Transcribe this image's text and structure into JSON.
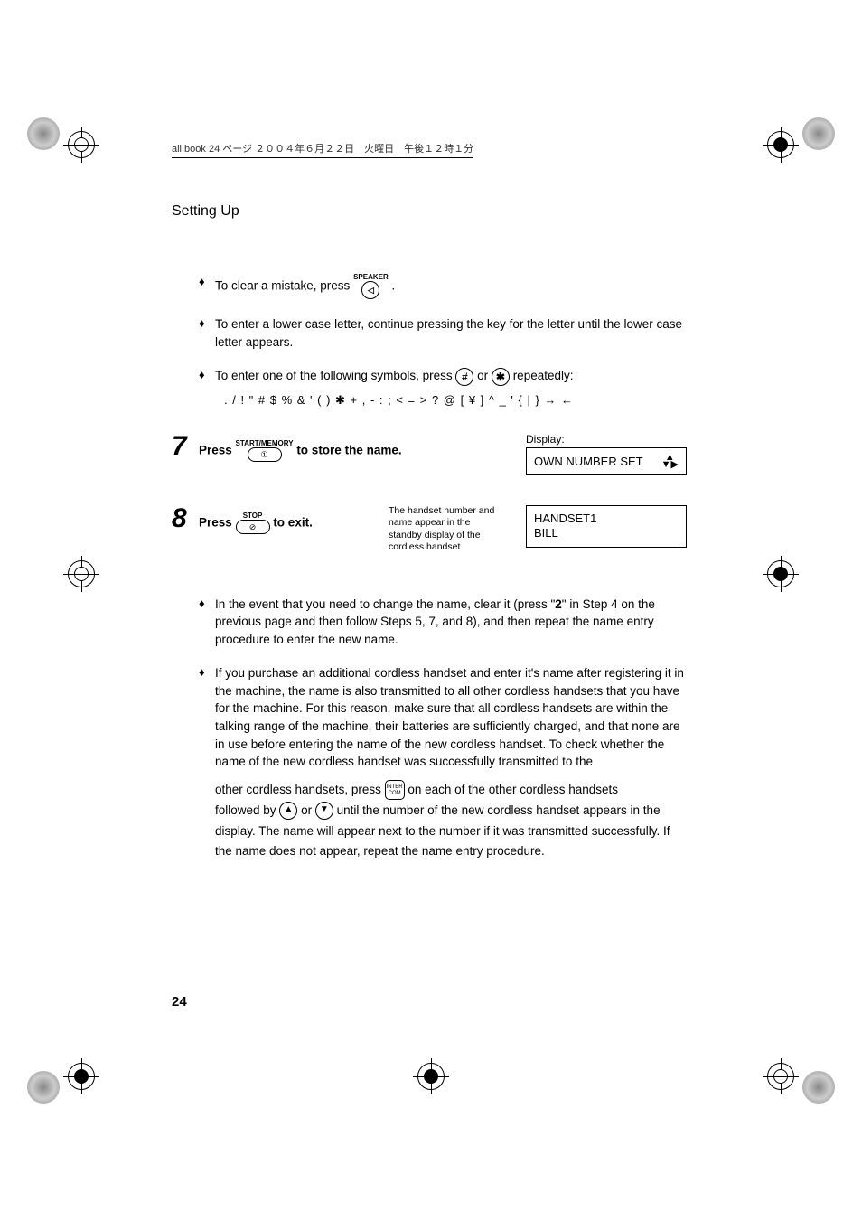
{
  "book_header": "all.book  24 ページ  ２００４年６月２２日　火曜日　午後１２時１分",
  "section_title": "Setting Up",
  "bullets": {
    "b1_pre": "To clear a mistake, press ",
    "b1_post": " .",
    "speaker_label": "SPEAKER",
    "b2": "To enter a lower case letter, continue pressing the key for the letter until the lower case letter appears.",
    "b3_pre": "To enter one of the following symbols, press ",
    "b3_mid": " or ",
    "b3_post": " repeatedly:",
    "hash": "#",
    "star": "✱",
    "symbols": ". / ! \" # $ % & ' ( ) ✱ + , - : ; < = > ? @ [ ¥ ] ^ _ ' { | } → ←"
  },
  "step7": {
    "num": "7",
    "press": "Press ",
    "btn_label": "START/MEMORY",
    "after": " to store the name.",
    "display_label": "Display:",
    "display_text": "OWN NUMBER SET"
  },
  "step8": {
    "num": "8",
    "press": "Press ",
    "btn_label": "STOP",
    "after": " to exit.",
    "mid_text": "The handset number and name appear in the standby display of the cordless handset",
    "display_line1": "HANDSET1",
    "display_line2": "BILL"
  },
  "para1_pre": "In the event that you need to change the name, clear it (press \"",
  "para1_bold": "2",
  "para1_post": "\" in Step 4 on the previous page and then follow Steps 5, 7, and 8), and then repeat the name entry procedure to enter the new name.",
  "para2": "If you purchase an additional cordless handset and enter it's name after registering it in the machine, the name is also transmitted to all other cordless handsets that you have for the machine. For this reason, make sure that all cordless handsets are within the talking range of the machine, their batteries are sufficiently charged, and that none are in use before entering the name of the new cordless handset. To check whether the name of the new cordless handset was successfully transmitted to the ",
  "para2b_pre": "other cordless handsets, press ",
  "para2b_post": " on each of the other cordless handsets ",
  "intercom_label": "INTER COM",
  "para2c_pre": "followed by ",
  "para2c_mid": " or ",
  "para2c_post": " until the number of the new cordless handset ",
  "para2d": "appears in the display. The name will appear next to the number if it was transmitted successfully. If the name does not appear, repeat the name entry procedure.",
  "page_number": "24"
}
